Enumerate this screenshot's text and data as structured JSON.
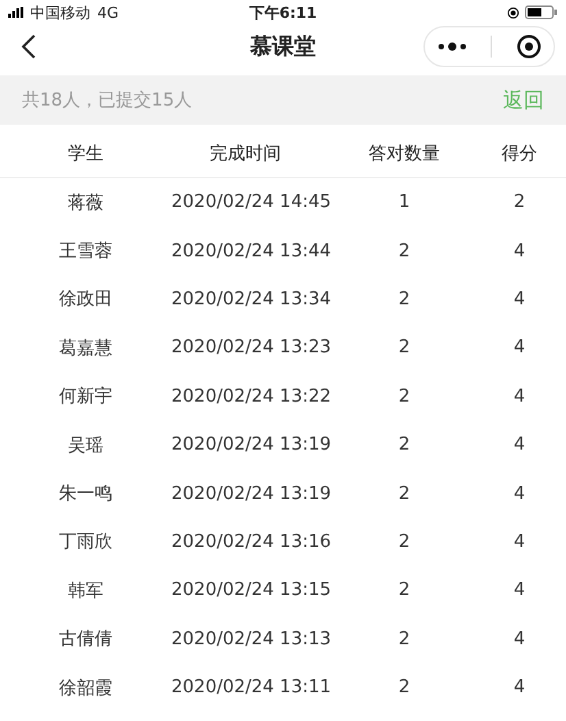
{
  "status_bar": {
    "carrier": "中国移动",
    "network": "4G",
    "time": "下午6:11"
  },
  "nav": {
    "title": "慕课堂"
  },
  "summary": {
    "text": "共18人，已提交15人",
    "action": "返回"
  },
  "table": {
    "columns": [
      "学生",
      "完成时间",
      "答对数量",
      "得分"
    ],
    "rows": [
      [
        "蒋薇",
        "2020/02/24 14:45",
        "1",
        "2"
      ],
      [
        "王雪蓉",
        "2020/02/24 13:44",
        "2",
        "4"
      ],
      [
        "徐政田",
        "2020/02/24 13:34",
        "2",
        "4"
      ],
      [
        "葛嘉慧",
        "2020/02/24 13:23",
        "2",
        "4"
      ],
      [
        "何新宇",
        "2020/02/24 13:22",
        "2",
        "4"
      ],
      [
        "吴瑶",
        "2020/02/24 13:19",
        "2",
        "4"
      ],
      [
        "朱一鸣",
        "2020/02/24 13:19",
        "2",
        "4"
      ],
      [
        "丁雨欣",
        "2020/02/24 13:16",
        "2",
        "4"
      ],
      [
        "韩军",
        "2020/02/24 13:15",
        "2",
        "4"
      ],
      [
        "古倩倩",
        "2020/02/24 13:13",
        "2",
        "4"
      ],
      [
        "徐韶霞",
        "2020/02/24 13:11",
        "2",
        "4"
      ]
    ]
  }
}
